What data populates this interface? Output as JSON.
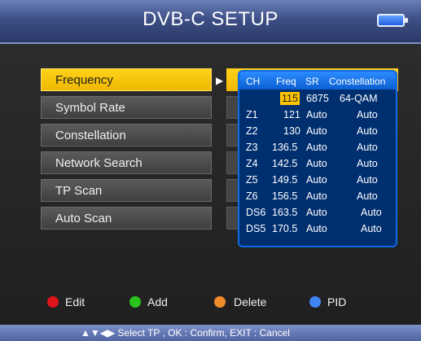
{
  "header": {
    "title": "DVB-C SETUP"
  },
  "menu": {
    "items": [
      {
        "label": "Frequency",
        "active": true
      },
      {
        "label": "Symbol Rate",
        "active": false
      },
      {
        "label": "Constellation",
        "active": false
      },
      {
        "label": "Network Search",
        "active": false
      },
      {
        "label": "TP Scan",
        "active": false
      },
      {
        "label": "Auto Scan",
        "active": false
      }
    ]
  },
  "tp_table": {
    "headers": [
      "CH",
      "Freq",
      "SR",
      "Constellation"
    ],
    "rows": [
      {
        "ch": "",
        "freq": "115",
        "sr": "6875",
        "con": "64-QAM"
      },
      {
        "ch": "Z1",
        "freq": "121",
        "sr": "Auto",
        "con": "Auto"
      },
      {
        "ch": "Z2",
        "freq": "130",
        "sr": "Auto",
        "con": "Auto"
      },
      {
        "ch": "Z3",
        "freq": "136.5",
        "sr": "Auto",
        "con": "Auto"
      },
      {
        "ch": "Z4",
        "freq": "142.5",
        "sr": "Auto",
        "con": "Auto"
      },
      {
        "ch": "Z5",
        "freq": "149.5",
        "sr": "Auto",
        "con": "Auto"
      },
      {
        "ch": "Z6",
        "freq": "156.5",
        "sr": "Auto",
        "con": "Auto"
      },
      {
        "ch": "DS6",
        "freq": "163.5",
        "sr": "Auto",
        "con": "Auto"
      },
      {
        "ch": "DS5",
        "freq": "170.5",
        "sr": "Auto",
        "con": "Auto"
      }
    ]
  },
  "legend": [
    {
      "label": "Edit",
      "color": "#e0141c"
    },
    {
      "label": "Add",
      "color": "#29c31d"
    },
    {
      "label": "Delete",
      "color": "#f08d2a"
    },
    {
      "label": "PID",
      "color": "#3f86f2"
    }
  ],
  "footer": {
    "hint": "▲▼◀▶ Select TP , OK : Confirm, EXIT : Cancel"
  }
}
